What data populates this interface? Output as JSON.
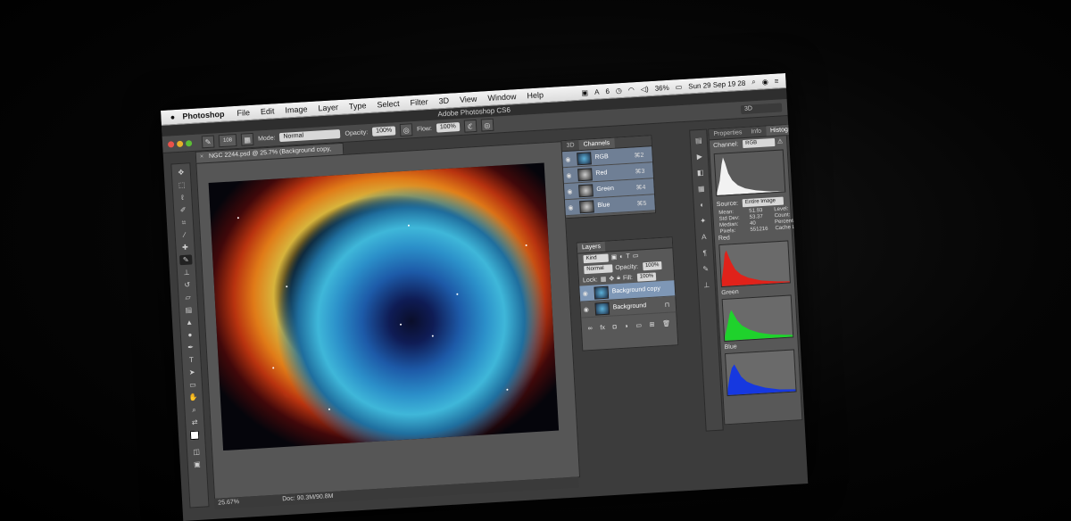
{
  "menubar": {
    "app": "Photoshop",
    "items": [
      "File",
      "Edit",
      "Image",
      "Layer",
      "Type",
      "Select",
      "Filter",
      "3D",
      "View",
      "Window",
      "Help"
    ],
    "battery": "36%",
    "clock": "Sun 29 Sep 19 28",
    "badge": "6"
  },
  "window_title": "Adobe Photoshop CS6",
  "options": {
    "brush_size": "108",
    "mode_label": "Mode:",
    "mode_value": "Normal",
    "opacity_label": "Opacity:",
    "opacity_value": "100%",
    "flow_label": "Flow:",
    "flow_value": "100%",
    "workspace": "3D"
  },
  "document": {
    "tab_title": "NGC 2244.psd @ 25.7% (Background copy, RGB/16) *",
    "zoom": "25.67%",
    "doc_info": "Doc: 90.3M/90.8M"
  },
  "channels_panel": {
    "tabs": [
      "3D",
      "Channels"
    ],
    "rows": [
      {
        "name": "RGB",
        "key": "⌘2"
      },
      {
        "name": "Red",
        "key": "⌘3"
      },
      {
        "name": "Green",
        "key": "⌘4"
      },
      {
        "name": "Blue",
        "key": "⌘5"
      }
    ]
  },
  "layers_panel": {
    "tab": "Layers",
    "kind": "Kind",
    "blend": "Normal",
    "opacity_label": "Opacity:",
    "opacity": "100%",
    "lock_label": "Lock:",
    "fill_label": "Fill:",
    "fill": "100%",
    "layers": [
      {
        "name": "Background copy",
        "selected": true
      },
      {
        "name": "Background",
        "selected": false
      }
    ]
  },
  "histogram_panel": {
    "tabs": [
      "Properties",
      "Info",
      "Histogram"
    ],
    "channel_label": "Channel:",
    "channel": "RGB",
    "source_label": "Source:",
    "source": "Entire Image",
    "stats": [
      {
        "label": "Mean:",
        "value": "51.93",
        "label2": "Level:",
        "value2": ""
      },
      {
        "label": "Std Dev:",
        "value": "53.37",
        "label2": "Count:",
        "value2": ""
      },
      {
        "label": "Median:",
        "value": "40",
        "label2": "Percentile:",
        "value2": ""
      },
      {
        "label": "Pixels:",
        "value": "551216",
        "label2": "Cache Level:",
        "value2": "2"
      }
    ],
    "channel_labels": [
      "Red",
      "Green",
      "Blue"
    ],
    "colors": {
      "rgb": "#f2f2f2",
      "red": "#e0221a",
      "green": "#1fd22c",
      "blue": "#1638e0"
    }
  }
}
